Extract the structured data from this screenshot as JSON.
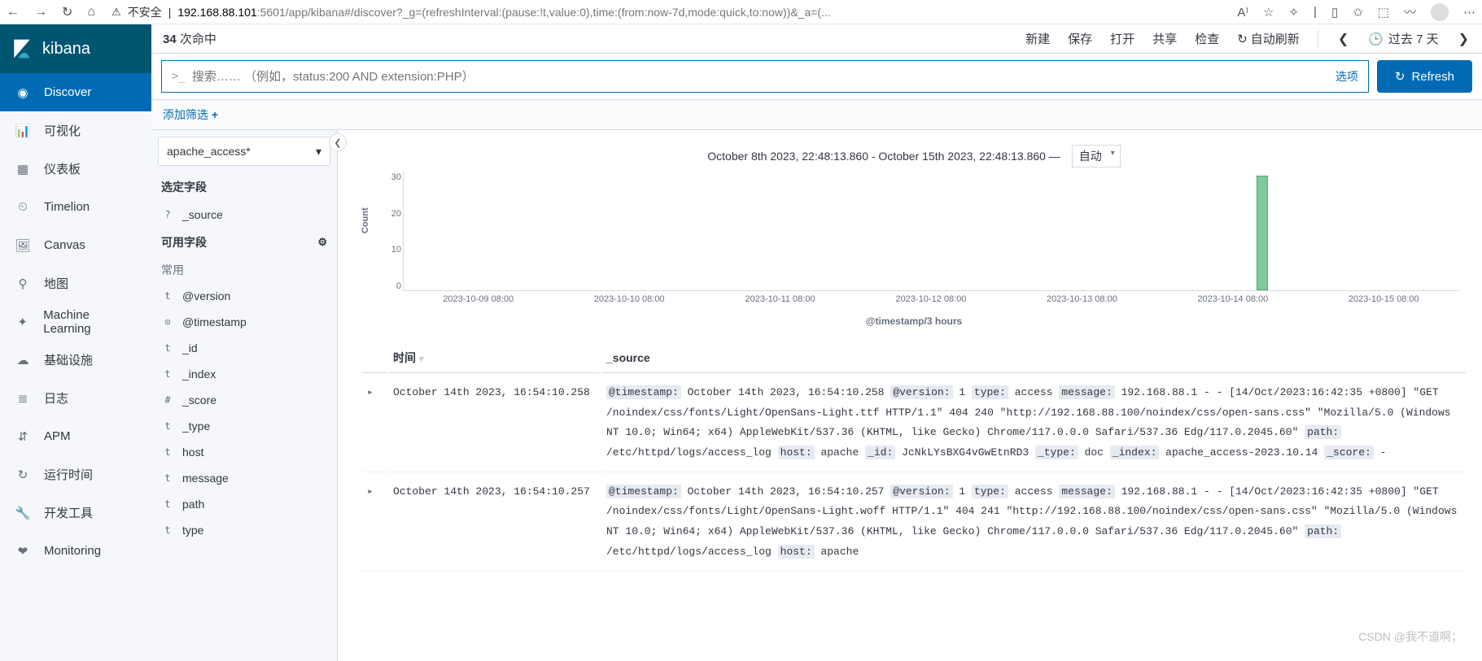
{
  "browser": {
    "insecure_label": "不安全",
    "url_host": "192.168.88.101",
    "url_path": ":5601/app/kibana#/discover?_g=(refreshInterval:(pause:!t,value:0),time:(from:now-7d,mode:quick,to:now))&_a=(...",
    "read_aloud": "A⁾"
  },
  "brand": {
    "name": "kibana"
  },
  "nav": {
    "items": [
      {
        "id": "discover",
        "label": "Discover",
        "active": true
      },
      {
        "id": "visualize",
        "label": "可视化"
      },
      {
        "id": "dashboard",
        "label": "仪表板"
      },
      {
        "id": "timelion",
        "label": "Timelion"
      },
      {
        "id": "canvas",
        "label": "Canvas"
      },
      {
        "id": "maps",
        "label": "地图"
      },
      {
        "id": "ml",
        "label": "Machine Learning"
      },
      {
        "id": "infra",
        "label": "基础设施"
      },
      {
        "id": "logs",
        "label": "日志"
      },
      {
        "id": "apm",
        "label": "APM"
      },
      {
        "id": "uptime",
        "label": "运行时间"
      },
      {
        "id": "devtools",
        "label": "开发工具"
      },
      {
        "id": "monitoring",
        "label": "Monitoring"
      }
    ]
  },
  "toolbar": {
    "hit_count": "34",
    "hit_label": " 次命中",
    "new": "新建",
    "save": "保存",
    "open": "打开",
    "share": "共享",
    "inspect": "检查",
    "auto_refresh": "自动刷新",
    "time_label": "过去 7 天"
  },
  "search": {
    "placeholder": "搜索…… （例如，status:200 AND extension:PHP）",
    "options_label": "选项",
    "refresh_label": "Refresh"
  },
  "filter": {
    "add_label": "添加筛选 "
  },
  "fields_bar": {
    "index_pattern": "apache_access*",
    "selected_title": "选定字段",
    "source_field": "_source",
    "available_title": "可用字段",
    "common_label": "常用",
    "fields": [
      {
        "type": "t",
        "name": "@version"
      },
      {
        "type": "⊙",
        "name": "@timestamp"
      },
      {
        "type": "t",
        "name": "_id"
      },
      {
        "type": "t",
        "name": "_index"
      },
      {
        "type": "#",
        "name": "_score"
      },
      {
        "type": "t",
        "name": "_type"
      },
      {
        "type": "t",
        "name": "host"
      },
      {
        "type": "t",
        "name": "message"
      },
      {
        "type": "t",
        "name": "path"
      },
      {
        "type": "t",
        "name": "type"
      }
    ]
  },
  "histogram": {
    "range_label": "October 8th 2023, 22:48:13.860 - October 15th 2023, 22:48:13.860 —",
    "interval_selected": "自动",
    "ylabel": "Count",
    "xlabel": "@timestamp/3 hours"
  },
  "chart_data": {
    "type": "bar",
    "ylabel": "Count",
    "xlabel": "@timestamp/3 hours",
    "ylim": [
      0,
      35
    ],
    "yticks": [
      30,
      20,
      10,
      0
    ],
    "xticks": [
      "2023-10-09 08:00",
      "2023-10-10 08:00",
      "2023-10-11 08:00",
      "2023-10-12 08:00",
      "2023-10-13 08:00",
      "2023-10-14 08:00",
      "2023-10-15 08:00"
    ],
    "bars": [
      {
        "x_frac": 0.808,
        "height": 34
      }
    ]
  },
  "table": {
    "time_header": "时间",
    "source_header": "_source",
    "rows": [
      {
        "time": "October 14th 2023, 16:54:10.258",
        "source": {
          "timestamp": "October 14th 2023, 16:54:10.258",
          "version": "1",
          "type": "access",
          "message": "192.168.88.1 - - [14/Oct/2023:16:42:35 +0800] \"GET /noindex/css/fonts/Light/OpenSans-Light.ttf HTTP/1.1\" 404 240 \"http://192.168.88.100/noindex/css/open-sans.css\" \"Mozilla/5.0 (Windows NT 10.0; Win64; x64) AppleWebKit/537.36 (KHTML, like Gecko) Chrome/117.0.0.0 Safari/537.36 Edg/117.0.2045.60\"",
          "path": "/etc/httpd/logs/access_log",
          "host": "apache",
          "id": "JcNkLYsBXG4vGwEtnRD3",
          "doc_type": "doc",
          "index": "apache_access-2023.10.14",
          "score": "-"
        }
      },
      {
        "time": "October 14th 2023, 16:54:10.257",
        "source": {
          "timestamp": "October 14th 2023, 16:54:10.257",
          "version": "1",
          "type": "access",
          "message": "192.168.88.1 - - [14/Oct/2023:16:42:35 +0800] \"GET /noindex/css/fonts/Light/OpenSans-Light.woff HTTP/1.1\" 404 241 \"http://192.168.88.100/noindex/css/open-sans.css\" \"Mozilla/5.0 (Windows NT 10.0; Win64; x64) AppleWebKit/537.36 (KHTML, like Gecko) Chrome/117.0.0.0 Safari/537.36 Edg/117.0.2045.60\"",
          "path": "/etc/httpd/logs/access_log",
          "host": "apache"
        }
      }
    ]
  },
  "watermark": "CSDN @我不道啊；"
}
